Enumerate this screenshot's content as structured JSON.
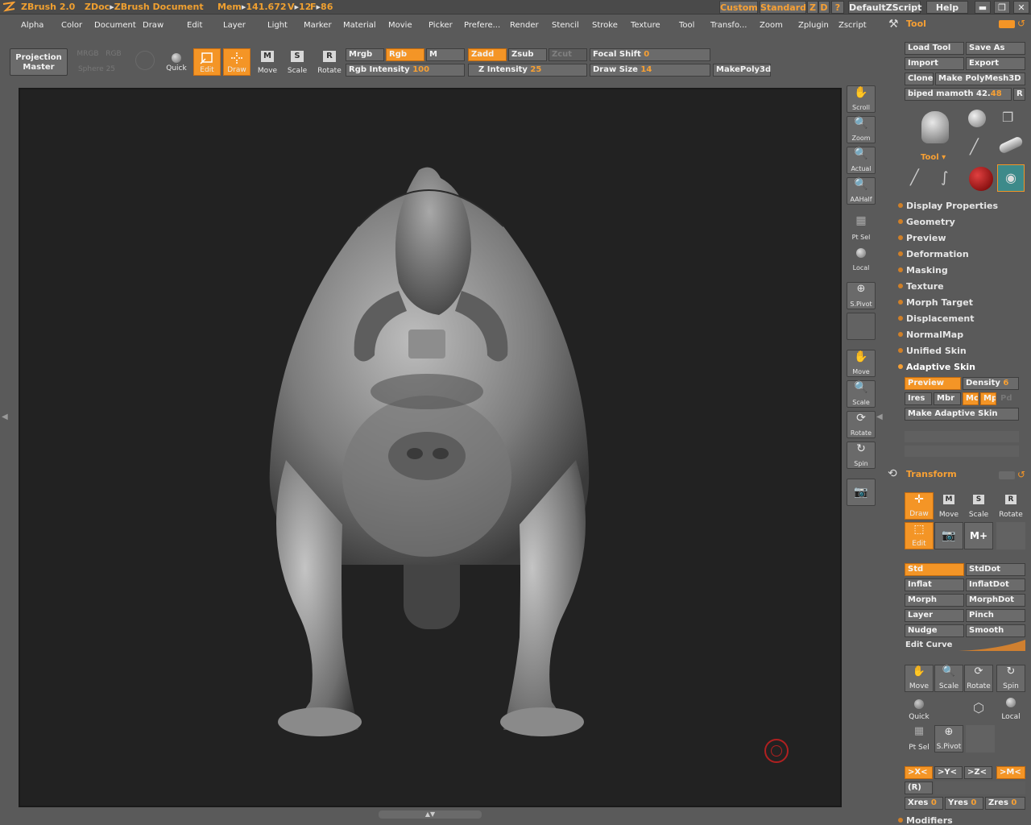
{
  "titlebar": {
    "app": "ZBrush 2.0",
    "doc_prefix": "ZDoc",
    "doc_name": "ZBrush Document",
    "mem": "Mem",
    "mem_val": "141.672",
    "v": "V",
    "v_val": "12",
    "f": "F",
    "f_val": "86",
    "btn_custom": "Custom",
    "btn_standard": "Standard",
    "btn_z": "Z",
    "btn_d": "D",
    "btn_help_q": "?",
    "btn_script": "DefaultZScript",
    "btn_help": "Help"
  },
  "menu": [
    "Alpha",
    "Color",
    "Document",
    "Draw",
    "Edit",
    "Layer",
    "Light",
    "Marker",
    "Material",
    "Movie",
    "Picker",
    "Prefere...",
    "Render",
    "Stencil",
    "Stroke",
    "Texture",
    "Tool",
    "Transfo...",
    "Zoom",
    "Zplugin",
    "Zscript"
  ],
  "toolbar": {
    "projection_master_1": "Projection",
    "projection_master_2": "Master",
    "dim_1": "MRGB",
    "dim_2": "RGB",
    "dim_3": "Sphere",
    "dim_4": "25",
    "quick": "Quick",
    "edit": "Edit",
    "draw": "Draw",
    "move": "Move",
    "scale": "Scale",
    "rotate": "Rotate",
    "mrgb": "Mrgb",
    "rgb": "Rgb",
    "m": "M",
    "zadd": "Zadd",
    "zsub": "Zsub",
    "zcut": "Zcut",
    "rgb_intensity_label": "Rgb Intensity",
    "rgb_intensity_val": "100",
    "z_intensity_label": "Z Intensity",
    "z_intensity_val": "25",
    "focal_shift_label": "Focal Shift",
    "focal_shift_val": "0",
    "draw_size_label": "Draw Size",
    "draw_size_val": "14",
    "makepoly3d": "MakePoly3d"
  },
  "rightcol": {
    "scroll": "Scroll",
    "zoom": "Zoom",
    "actual": "Actual",
    "aahalf": "AAHalf",
    "ptsel": "Pt Sel",
    "local": "Local",
    "spivot": "S.Pivot",
    "move": "Move",
    "scale": "Scale",
    "rotate": "Rotate",
    "spin": "Spin"
  },
  "toolpanel": {
    "title": "Tool",
    "load_tool": "Load Tool",
    "save_as": "Save As",
    "import": "Import",
    "export": "Export",
    "clone": "Clone",
    "make_polymesh": "Make PolyMesh3D",
    "tool_name": "biped mamoth",
    "tool_val": "42.",
    "tool_val2": "48",
    "r_btn": "R",
    "tool_thumb_label": "Tool",
    "sections": [
      "Display Properties",
      "Geometry",
      "Preview",
      "Deformation",
      "Masking",
      "Texture",
      "Morph Target",
      "Displacement",
      "NormalMap",
      "Unified Skin",
      "Adaptive Skin"
    ],
    "preview": "Preview",
    "density_label": "Density",
    "density_val": "6",
    "ires": "Ires",
    "mbr": "Mbr",
    "mc": "Mc",
    "mp": "Mp",
    "pd": "Pd",
    "make_adaptive": "Make Adaptive Skin"
  },
  "transform": {
    "title": "Transform",
    "draw": "Draw",
    "move": "Move",
    "scale": "Scale",
    "rotate": "Rotate",
    "edit": "Edit",
    "brushes": [
      [
        "Std",
        "StdDot"
      ],
      [
        "Inflat",
        "InflatDot"
      ],
      [
        "Morph",
        "MorphDot"
      ],
      [
        "Layer",
        "Pinch"
      ],
      [
        "Nudge",
        "Smooth"
      ]
    ],
    "edit_curve": "Edit Curve",
    "t_move": "Move",
    "t_scale": "Scale",
    "t_rotate": "Rotate",
    "t_spin": "Spin",
    "quick": "Quick",
    "local": "Local",
    "ptsel": "Pt Sel",
    "spivot": "S.Pivot",
    "sym_x": ">X<",
    "sym_y": ">Y<",
    "sym_z": ">Z<",
    "sym_m": ">M<",
    "sym_r": "(R)",
    "xres": "Xres",
    "xres_val": "0",
    "yres": "Yres",
    "yres_val": "0",
    "zres": "Zres",
    "zres_val": "0",
    "modifiers": "Modifiers"
  },
  "colors": {
    "accent": "#f49526",
    "canvas": "#222222",
    "ui": "#5a5a5a"
  }
}
